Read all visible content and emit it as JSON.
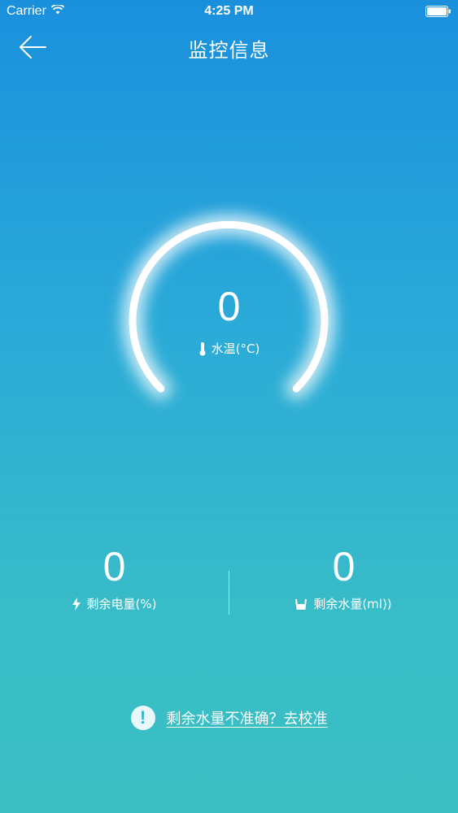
{
  "status_bar": {
    "carrier": "Carrier",
    "time": "4:25 PM",
    "icons": {
      "wifi": "wifi-icon",
      "battery": "battery-icon"
    }
  },
  "nav": {
    "title": "监控信息",
    "back_icon": "back-arrow-icon"
  },
  "gauge": {
    "value": "0",
    "label": "水温(°C)",
    "icon": "thermometer-icon"
  },
  "stats": {
    "battery": {
      "value": "0",
      "label": "剩余电量(%)",
      "icon": "lightning-icon"
    },
    "water": {
      "value": "0",
      "label": "剩余水量(ml))",
      "icon": "cup-icon"
    }
  },
  "calibrate": {
    "text": "剩余水量不准确？去校准",
    "icon": "exclamation-icon"
  },
  "colors": {
    "gradient_top": "#1a90dd",
    "gradient_bottom": "#3cc0c4",
    "foreground": "#ffffff"
  }
}
